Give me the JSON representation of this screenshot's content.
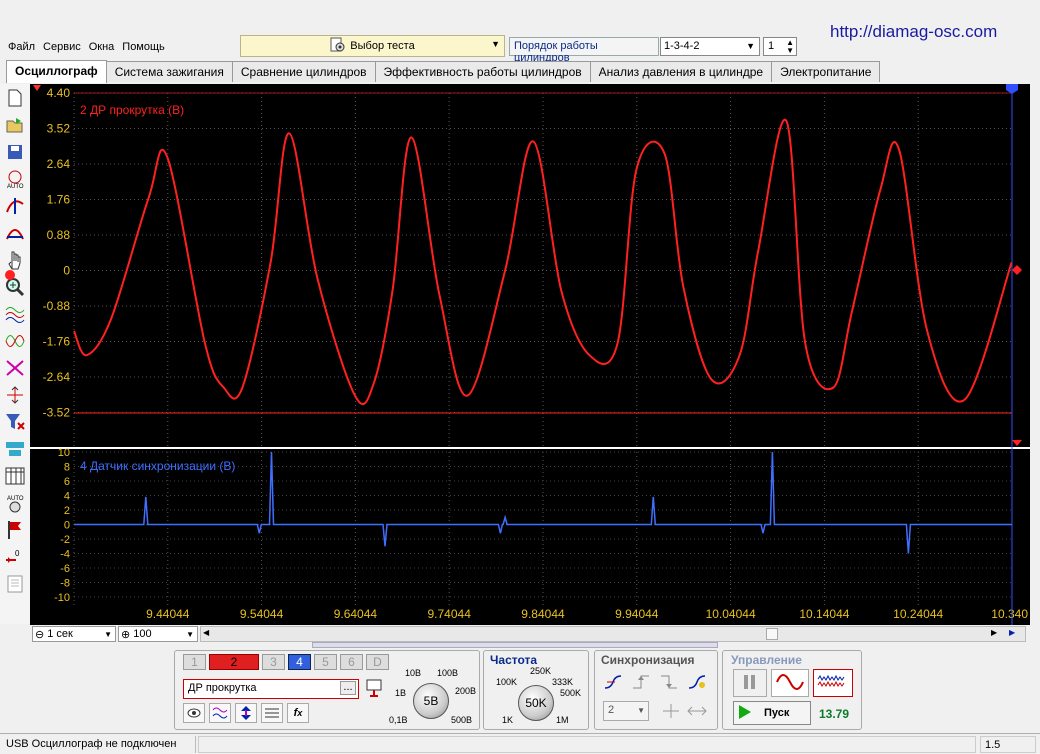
{
  "website": "http://diamag-osc.com",
  "menu": [
    "Файл",
    "Сервис",
    "Окна",
    "Помощь"
  ],
  "test_select": {
    "label": "Выбор теста"
  },
  "firing_order": {
    "label": "Порядок работы цилиндров",
    "value": "1-3-4-2",
    "cylinder": "1"
  },
  "tabs": [
    "Осциллограф",
    "Система зажигания",
    "Сравнение цилиндров",
    "Эффективность работы цилиндров",
    "Анализ давления в цилиндре",
    "Электропитание"
  ],
  "active_tab": 0,
  "colors": {
    "ch2": "#ff2020",
    "ch4": "#3f6fff",
    "ch2_btn": "#e02020",
    "ch4_btn": "#3060e0"
  },
  "chart_data": [
    {
      "type": "line",
      "title": "2 ДР прокрутка (В)",
      "series": [
        {
          "name": "2 ДР прокрутка (В)"
        }
      ],
      "y_ticks": [
        "4.40",
        "3.52",
        "2.64",
        "1.76",
        "0.88",
        "0",
        "-0.88",
        "-1.76",
        "-2.64",
        "-3.52"
      ],
      "ylim": [
        -4.4,
        4.4
      ],
      "xlim": [
        9.34044,
        10.34044
      ],
      "x": [
        9.34044,
        9.354,
        9.38,
        9.42,
        9.44,
        9.48,
        9.5,
        9.52,
        9.55,
        9.57,
        9.6,
        9.64,
        9.66,
        9.68,
        9.7,
        9.73,
        9.76,
        9.8,
        9.83,
        9.86,
        9.89,
        9.92,
        9.94,
        9.97,
        9.99,
        10.02,
        10.05,
        10.07,
        10.1,
        10.12,
        10.15,
        10.17,
        10.2,
        10.22,
        10.25,
        10.29,
        10.34
      ],
      "y": [
        -1.5,
        -2.1,
        -1.2,
        1.8,
        2.8,
        -1.8,
        -2.9,
        -2.9,
        0.2,
        3.4,
        -0.2,
        -3.1,
        -2.8,
        -0.5,
        3.3,
        -0.6,
        -3.1,
        0.0,
        3.2,
        -0.5,
        -2.1,
        -1.8,
        2.5,
        2.9,
        -0.4,
        -2.7,
        -2.1,
        0.5,
        3.7,
        -1.8,
        -2.9,
        -1.0,
        2.0,
        3.0,
        -1.5,
        -3.2,
        0.2
      ]
    },
    {
      "type": "line",
      "title": "4 Датчик синхронизации (В)",
      "series": [
        {
          "name": "4 Датчик синхронизации (В)"
        }
      ],
      "y_ticks": [
        "10",
        "8",
        "6",
        "4",
        "2",
        "0",
        "-2",
        "-4",
        "-6",
        "-8",
        "-10"
      ],
      "ylim": [
        -10,
        10
      ],
      "xlim": [
        9.34044,
        10.34044
      ],
      "spikes": [
        {
          "x": 9.417,
          "y": 3.8
        },
        {
          "x": 9.538,
          "y": -1.2
        },
        {
          "x": 9.551,
          "y": 10
        },
        {
          "x": 9.672,
          "y": -3.0
        },
        {
          "x": 9.795,
          "y": -1.2
        },
        {
          "x": 9.8,
          "y": 1.0
        },
        {
          "x": 9.958,
          "y": 3.8
        },
        {
          "x": 10.075,
          "y": -1.2
        },
        {
          "x": 10.085,
          "y": 10
        },
        {
          "x": 10.23,
          "y": -4.0
        }
      ],
      "x_ticks": [
        "9.44044",
        "9.54044",
        "9.64044",
        "9.74044",
        "9.84044",
        "9.94044",
        "10.04044",
        "10.14044",
        "10.24044",
        "10.340"
      ]
    }
  ],
  "timebase": {
    "value": "1 сек",
    "zoom": "100"
  },
  "channels": {
    "buttons": [
      "1",
      "2",
      "3",
      "4",
      "5",
      "6",
      "D"
    ],
    "selected_name": "ДР прокрутка"
  },
  "voltage": {
    "value": "5В",
    "ticks": [
      "10В",
      "100В",
      "1В",
      "200В",
      "0,1В",
      "500В"
    ]
  },
  "frequency": {
    "title": "Частота",
    "value": "50K",
    "ticks": [
      "250K",
      "100K",
      "333K",
      "500K",
      "1K",
      "1M"
    ]
  },
  "sync": {
    "title": "Синхронизация",
    "channel": "2"
  },
  "control": {
    "title": "Управление",
    "start": "Пуск",
    "fps": "13.79"
  },
  "status": {
    "text": "USB Осциллограф не подключен",
    "version": "1.5"
  }
}
